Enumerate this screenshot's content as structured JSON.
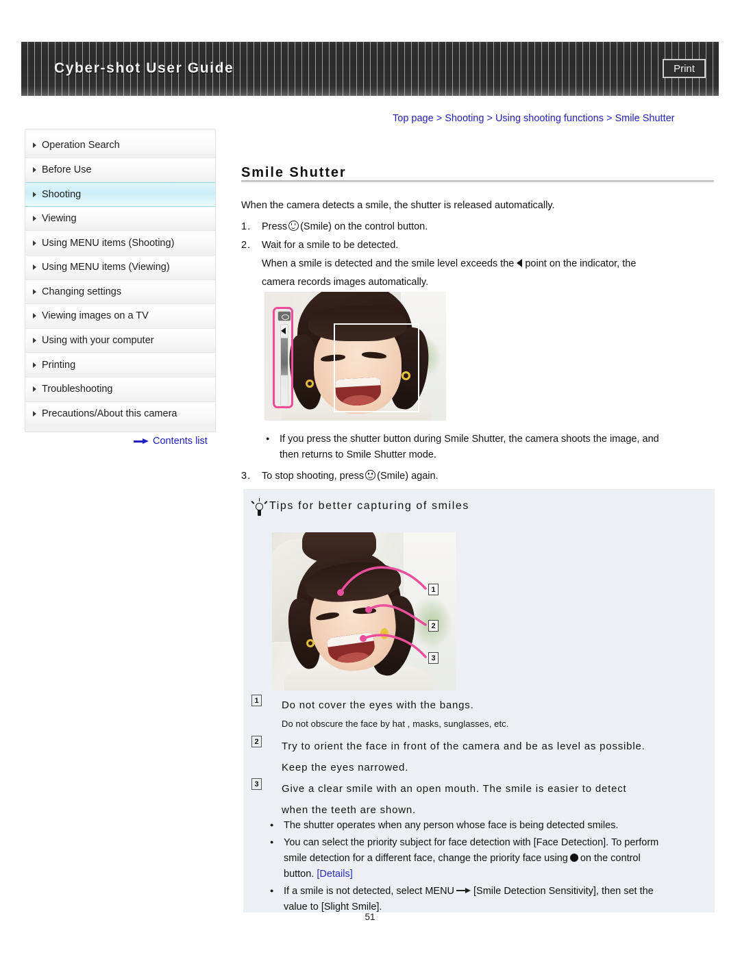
{
  "header": {
    "title": "Cyber-shot User Guide",
    "print_label": "Print"
  },
  "breadcrumb": {
    "text": "Top page > Shooting > Using shooting functions > Smile Shutter"
  },
  "sidebar": {
    "items": [
      {
        "label": "Operation Search",
        "active": false
      },
      {
        "label": "Before Use",
        "active": false
      },
      {
        "label": "Shooting",
        "active": true
      },
      {
        "label": "Viewing",
        "active": false
      },
      {
        "label": "Using MENU items (Shooting)",
        "active": false
      },
      {
        "label": "Using MENU items (Viewing)",
        "active": false
      },
      {
        "label": "Changing settings",
        "active": false
      },
      {
        "label": "Viewing images on a TV",
        "active": false
      },
      {
        "label": "Using with your computer",
        "active": false
      },
      {
        "label": "Printing",
        "active": false
      },
      {
        "label": "Troubleshooting",
        "active": false
      },
      {
        "label": "Precautions/About this camera",
        "active": false
      }
    ],
    "contents_link": "Contents list"
  },
  "main": {
    "title": "Smile Shutter",
    "intro": "When the camera detects a smile, the shutter is released automatically.",
    "step1_num": "1.",
    "step1_pre": "Press",
    "step1_post": "(Smile) on the control button.",
    "step2_num": "2.",
    "step2_line1": "Wait for a smile to be detected.",
    "step2_line2_pre": "When a smile is detected and the smile level exceeds the",
    "step2_line2_post": "point on the indicator, the",
    "step2_line3": "camera records images automatically.",
    "note_after_photo_line1": "If you press the shutter button during Smile Shutter, the camera shoots the image, and",
    "note_after_photo_line2": "then returns to Smile Shutter mode.",
    "step3_num": "3.",
    "step3_pre": "To stop shooting, press",
    "step3_post": "(Smile) again."
  },
  "tips": {
    "heading": "Tips for better capturing of smiles",
    "callout_labels": [
      "1",
      "2",
      "3"
    ],
    "items": [
      {
        "num": "1",
        "text": "Do not cover the eyes with the bangs.",
        "sub": "Do not obscure the face by hat , masks, sunglasses, etc."
      },
      {
        "num": "2",
        "text": "Try to orient the face in front of the camera and be as level as possible.",
        "text2": "Keep the eyes narrowed."
      },
      {
        "num": "3",
        "text": "Give a clear smile with an open mouth. The smile is easier to detect",
        "text2": "when the teeth are shown."
      }
    ],
    "notes": [
      {
        "line1": "The shutter operates when any person whose face is being detected smiles."
      },
      {
        "line1": "You can select the priority subject for face detection with [Face Detection]. To perform",
        "line2_pre": "smile detection for a different face, change the priority face using",
        "line2_post": "on the control",
        "line3_pre": "button.",
        "link": "[Details]"
      },
      {
        "line1_pre": "If a smile is not detected, select MENU",
        "line1_post": "[Smile Detection Sensitivity], then set the",
        "line2": "value to [Slight Smile]."
      }
    ]
  },
  "footer": {
    "page_number": "51"
  },
  "colors": {
    "accent_pink": "#f04a9a",
    "link_blue": "#2222bb",
    "tips_bg": "#eceff4",
    "active_nav": "#cdeef7"
  }
}
